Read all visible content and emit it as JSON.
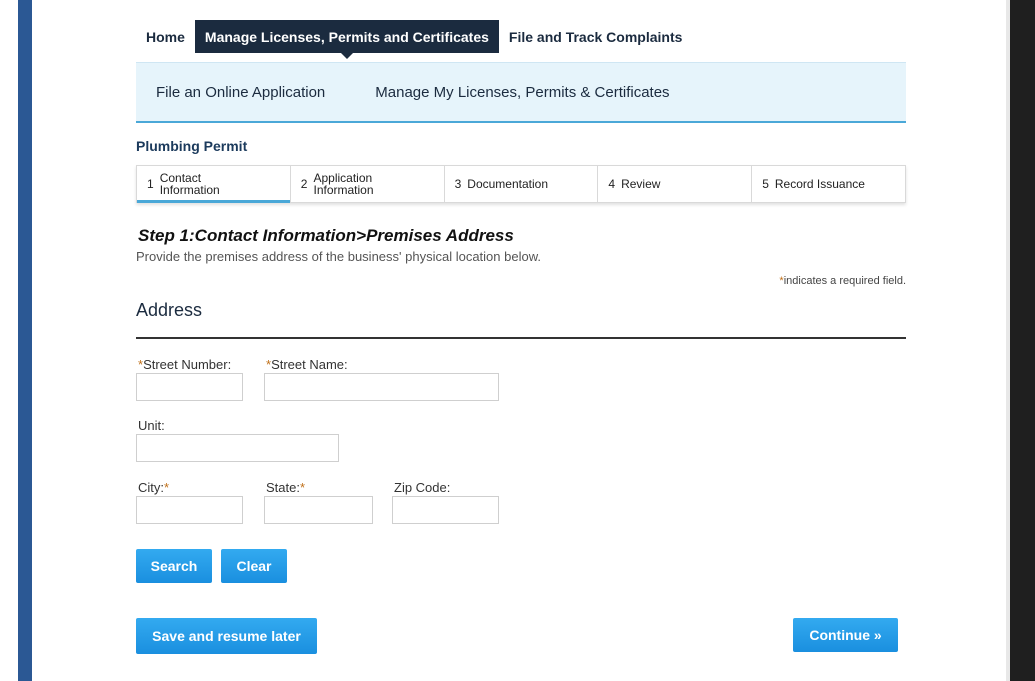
{
  "nav": {
    "home": "Home",
    "manage": "Manage Licenses, Permits and Certificates",
    "complaints": "File and Track Complaints"
  },
  "subnav": {
    "file_online": "File an Online Application",
    "manage_my": "Manage My Licenses, Permits & Certificates"
  },
  "permit_title": "Plumbing Permit",
  "steps": [
    {
      "num": "1",
      "label": "Contact Information",
      "active": true
    },
    {
      "num": "2",
      "label": "Application Information",
      "active": false
    },
    {
      "num": "3",
      "label": "Documentation",
      "active": false
    },
    {
      "num": "4",
      "label": "Review",
      "active": false
    },
    {
      "num": "5",
      "label": "Record Issuance",
      "active": false
    }
  ],
  "step_heading": "Step 1:Contact Information>Premises Address",
  "step_description": "Provide the premises address of the business' physical location below.",
  "required_note": {
    "star": "*",
    "text": "indicates a required field."
  },
  "section_title": "Address",
  "fields": {
    "street_number": {
      "label": "Street Number:",
      "required": "*",
      "value": ""
    },
    "street_name": {
      "label": "Street Name:",
      "required": "*",
      "value": ""
    },
    "unit": {
      "label": "Unit:",
      "value": ""
    },
    "city": {
      "label": "City:",
      "required": "*",
      "value": ""
    },
    "state": {
      "label": "State:",
      "required": "*",
      "value": ""
    },
    "zip": {
      "label": "Zip Code:",
      "value": ""
    }
  },
  "buttons": {
    "search": "Search",
    "clear": "Clear",
    "save_resume": "Save and resume later",
    "continue": "Continue »"
  },
  "colors": {
    "nav_active": "#1b2b3f",
    "subnav_bg": "#e6f4fb",
    "accent": "#4aa8d8",
    "button": "#1a8fdf",
    "required": "#c0701a"
  }
}
